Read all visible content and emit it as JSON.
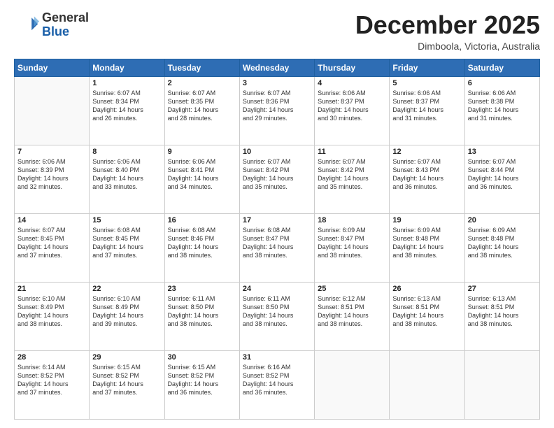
{
  "logo": {
    "line1": "General",
    "line2": "Blue"
  },
  "header": {
    "title": "December 2025",
    "location": "Dimboola, Victoria, Australia"
  },
  "days_of_week": [
    "Sunday",
    "Monday",
    "Tuesday",
    "Wednesday",
    "Thursday",
    "Friday",
    "Saturday"
  ],
  "weeks": [
    [
      {
        "day": "",
        "info": ""
      },
      {
        "day": "1",
        "info": "Sunrise: 6:07 AM\nSunset: 8:34 PM\nDaylight: 14 hours\nand 26 minutes."
      },
      {
        "day": "2",
        "info": "Sunrise: 6:07 AM\nSunset: 8:35 PM\nDaylight: 14 hours\nand 28 minutes."
      },
      {
        "day": "3",
        "info": "Sunrise: 6:07 AM\nSunset: 8:36 PM\nDaylight: 14 hours\nand 29 minutes."
      },
      {
        "day": "4",
        "info": "Sunrise: 6:06 AM\nSunset: 8:37 PM\nDaylight: 14 hours\nand 30 minutes."
      },
      {
        "day": "5",
        "info": "Sunrise: 6:06 AM\nSunset: 8:37 PM\nDaylight: 14 hours\nand 31 minutes."
      },
      {
        "day": "6",
        "info": "Sunrise: 6:06 AM\nSunset: 8:38 PM\nDaylight: 14 hours\nand 31 minutes."
      }
    ],
    [
      {
        "day": "7",
        "info": "Sunrise: 6:06 AM\nSunset: 8:39 PM\nDaylight: 14 hours\nand 32 minutes."
      },
      {
        "day": "8",
        "info": "Sunrise: 6:06 AM\nSunset: 8:40 PM\nDaylight: 14 hours\nand 33 minutes."
      },
      {
        "day": "9",
        "info": "Sunrise: 6:06 AM\nSunset: 8:41 PM\nDaylight: 14 hours\nand 34 minutes."
      },
      {
        "day": "10",
        "info": "Sunrise: 6:07 AM\nSunset: 8:42 PM\nDaylight: 14 hours\nand 35 minutes."
      },
      {
        "day": "11",
        "info": "Sunrise: 6:07 AM\nSunset: 8:42 PM\nDaylight: 14 hours\nand 35 minutes."
      },
      {
        "day": "12",
        "info": "Sunrise: 6:07 AM\nSunset: 8:43 PM\nDaylight: 14 hours\nand 36 minutes."
      },
      {
        "day": "13",
        "info": "Sunrise: 6:07 AM\nSunset: 8:44 PM\nDaylight: 14 hours\nand 36 minutes."
      }
    ],
    [
      {
        "day": "14",
        "info": "Sunrise: 6:07 AM\nSunset: 8:45 PM\nDaylight: 14 hours\nand 37 minutes."
      },
      {
        "day": "15",
        "info": "Sunrise: 6:08 AM\nSunset: 8:45 PM\nDaylight: 14 hours\nand 37 minutes."
      },
      {
        "day": "16",
        "info": "Sunrise: 6:08 AM\nSunset: 8:46 PM\nDaylight: 14 hours\nand 38 minutes."
      },
      {
        "day": "17",
        "info": "Sunrise: 6:08 AM\nSunset: 8:47 PM\nDaylight: 14 hours\nand 38 minutes."
      },
      {
        "day": "18",
        "info": "Sunrise: 6:09 AM\nSunset: 8:47 PM\nDaylight: 14 hours\nand 38 minutes."
      },
      {
        "day": "19",
        "info": "Sunrise: 6:09 AM\nSunset: 8:48 PM\nDaylight: 14 hours\nand 38 minutes."
      },
      {
        "day": "20",
        "info": "Sunrise: 6:09 AM\nSunset: 8:48 PM\nDaylight: 14 hours\nand 38 minutes."
      }
    ],
    [
      {
        "day": "21",
        "info": "Sunrise: 6:10 AM\nSunset: 8:49 PM\nDaylight: 14 hours\nand 38 minutes."
      },
      {
        "day": "22",
        "info": "Sunrise: 6:10 AM\nSunset: 8:49 PM\nDaylight: 14 hours\nand 39 minutes."
      },
      {
        "day": "23",
        "info": "Sunrise: 6:11 AM\nSunset: 8:50 PM\nDaylight: 14 hours\nand 38 minutes."
      },
      {
        "day": "24",
        "info": "Sunrise: 6:11 AM\nSunset: 8:50 PM\nDaylight: 14 hours\nand 38 minutes."
      },
      {
        "day": "25",
        "info": "Sunrise: 6:12 AM\nSunset: 8:51 PM\nDaylight: 14 hours\nand 38 minutes."
      },
      {
        "day": "26",
        "info": "Sunrise: 6:13 AM\nSunset: 8:51 PM\nDaylight: 14 hours\nand 38 minutes."
      },
      {
        "day": "27",
        "info": "Sunrise: 6:13 AM\nSunset: 8:51 PM\nDaylight: 14 hours\nand 38 minutes."
      }
    ],
    [
      {
        "day": "28",
        "info": "Sunrise: 6:14 AM\nSunset: 8:52 PM\nDaylight: 14 hours\nand 37 minutes."
      },
      {
        "day": "29",
        "info": "Sunrise: 6:15 AM\nSunset: 8:52 PM\nDaylight: 14 hours\nand 37 minutes."
      },
      {
        "day": "30",
        "info": "Sunrise: 6:15 AM\nSunset: 8:52 PM\nDaylight: 14 hours\nand 36 minutes."
      },
      {
        "day": "31",
        "info": "Sunrise: 6:16 AM\nSunset: 8:52 PM\nDaylight: 14 hours\nand 36 minutes."
      },
      {
        "day": "",
        "info": ""
      },
      {
        "day": "",
        "info": ""
      },
      {
        "day": "",
        "info": ""
      }
    ]
  ]
}
